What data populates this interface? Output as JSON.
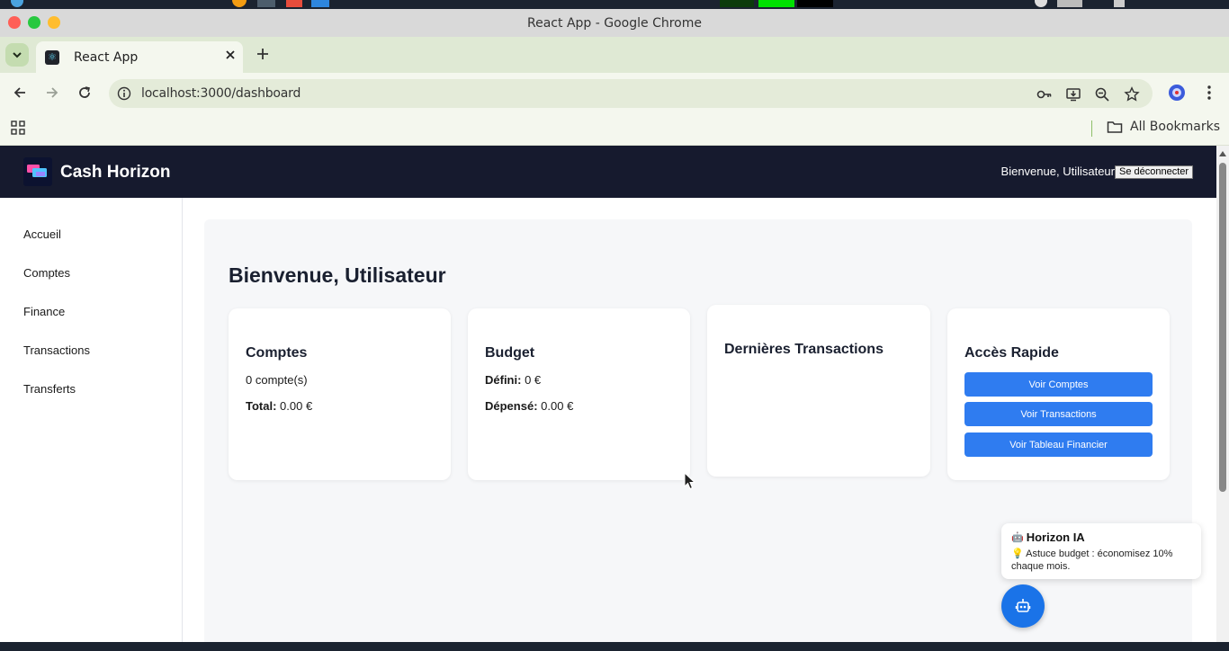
{
  "window": {
    "title": "React App - Google Chrome"
  },
  "browser": {
    "tab_title": "React App",
    "url": "localhost:3000/dashboard",
    "bookmarks_label": "All Bookmarks"
  },
  "app": {
    "brand": "Cash Horizon",
    "greeting": "Bienvenue, Utilisateur",
    "logout_label": "Se déconnecter"
  },
  "sidebar": {
    "items": [
      {
        "label": "Accueil"
      },
      {
        "label": "Comptes"
      },
      {
        "label": "Finance"
      },
      {
        "label": "Transactions"
      },
      {
        "label": "Transferts"
      }
    ]
  },
  "dashboard": {
    "title": "Bienvenue, Utilisateur",
    "accounts_card": {
      "title": "Comptes",
      "count_text": "0 compte(s)",
      "total_label": "Total:",
      "total_value": "0.00 €"
    },
    "budget_card": {
      "title": "Budget",
      "defined_label": "Défini:",
      "defined_value": "0 €",
      "spent_label": "Dépensé:",
      "spent_value": "0.00 €"
    },
    "transactions_card": {
      "title": "Dernières Transactions"
    },
    "quick_card": {
      "title": "Accès Rapide",
      "buttons": [
        {
          "label": "Voir Comptes"
        },
        {
          "label": "Voir Transactions"
        },
        {
          "label": "Voir Tableau Financier"
        }
      ]
    }
  },
  "assistant": {
    "emoji": "🤖",
    "title": "Horizon IA",
    "tip": "💡 Astuce budget : économisez 10% chaque mois."
  },
  "colors": {
    "header_bg": "#161a2e",
    "button_blue": "#2f7cf0",
    "fab_blue": "#1a73e8",
    "panel_bg": "#f6f7f9"
  }
}
